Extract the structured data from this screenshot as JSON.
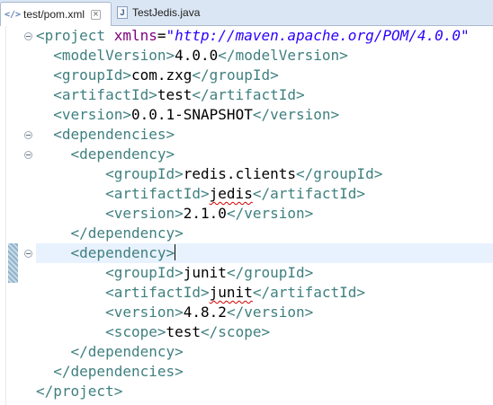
{
  "tabs": [
    {
      "label": "test/pom.xml",
      "icon": "xml-file-icon",
      "active": true
    },
    {
      "label": "TestJedis.java",
      "icon": "java-file-icon",
      "active": false
    }
  ],
  "code": {
    "project_open": "<project",
    "xmlns_attr": "xmlns",
    "xmlns_eq": "=",
    "xmlns_value": "\"http://maven.apache.org/POM/4.0.0\"",
    "modelVersion_open": "<modelVersion>",
    "modelVersion_value": "4.0.0",
    "modelVersion_close": "</modelVersion>",
    "groupId_open": "<groupId>",
    "groupId_value": "com.zxg",
    "groupId_close": "</groupId>",
    "artifactId_open": "<artifactId>",
    "artifactId_value": "test",
    "artifactId_close": "</artifactId>",
    "version_open": "<version>",
    "version_value": "0.0.1-SNAPSHOT",
    "version_close": "</version>",
    "dependencies_open": "<dependencies>",
    "dep1_open": "<dependency>",
    "dep1_groupId_open": "<groupId>",
    "dep1_groupId_value": "redis.clients",
    "dep1_groupId_close": "</groupId>",
    "dep1_artifactId_open": "<artifactId>",
    "dep1_artifactId_value": "jedis",
    "dep1_artifactId_close": "</artifactId>",
    "dep1_version_open": "<version>",
    "dep1_version_value": "2.1.0",
    "dep1_version_close": "</version>",
    "dep1_close": "</dependency>",
    "dep2_open": "<dependency>",
    "dep2_groupId_open": "<groupId>",
    "dep2_groupId_value": "junit",
    "dep2_groupId_close": "</groupId>",
    "dep2_artifactId_open": "<artifactId>",
    "dep2_artifactId_value": "junit",
    "dep2_artifactId_close": "</artifactId>",
    "dep2_version_open": "<version>",
    "dep2_version_value": "4.8.2",
    "dep2_version_close": "</version>",
    "dep2_scope_open": "<scope>",
    "dep2_scope_value": "test",
    "dep2_scope_close": "</scope>",
    "dep2_close": "</dependency>",
    "dependencies_close": "</dependencies>",
    "project_close": "</project>"
  },
  "colors": {
    "tag": "#3f7f7f",
    "attribute": "#7f007f",
    "string": "#2a00ff",
    "text": "#000000",
    "current_line": "#e8f2fe"
  }
}
